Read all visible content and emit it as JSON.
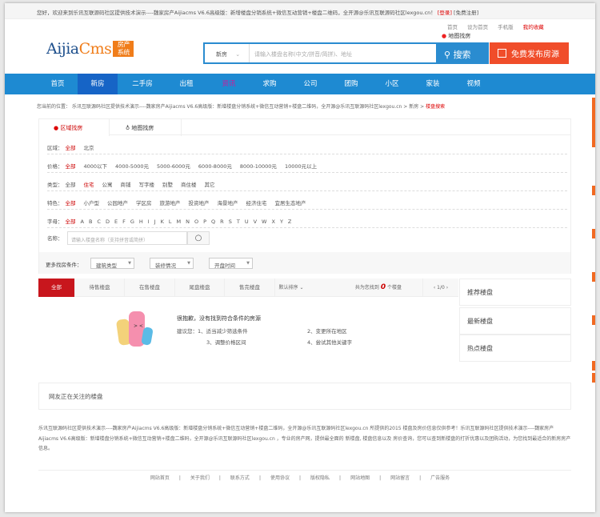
{
  "topbar": {
    "welcome": "您好，欢迎来到乐讯互联源码社区提供技术演示----魏家房产Aijiacms V6.6高级版：新增楼盘分销系统+微信互动营销+楼盘二维码，全开源@乐讯互联源码社区lexgou.cn！",
    "login": "[登录]",
    "register": "[免费注册]"
  },
  "toplinks": [
    "首页",
    "设为首页",
    "手机版",
    "我的收藏"
  ],
  "map_find": "地图找房",
  "logo": {
    "text1": "Aijia",
    "text2": "Cms",
    "tag1": "房产",
    "tag2": "系统"
  },
  "search": {
    "type": "新房",
    "placeholder": "请输入楼盘名称(中文/拼音/简拼)、地址",
    "button": "搜索"
  },
  "publish_button": "免费发布房源",
  "nav": [
    "首页",
    "新房",
    "二手房",
    "出租",
    "资讯",
    "求购",
    "公司",
    "团购",
    "小区",
    "家装",
    "视频"
  ],
  "breadcrumb": {
    "prefix": "您当前的位置：",
    "site": "乐讯互联源码社区提供技术演示----魏家房产Aijiacms V6.6高级版：新增楼盘分销系统+微信互动营销+楼盘二维码，全开源@乐讯互联源码社区lexgou.cn",
    "sep": ">",
    "item1": "新房",
    "item2": "楼盘搜索"
  },
  "filter": {
    "tabs": [
      "区域找房",
      "地图找房"
    ],
    "rows": [
      {
        "label": "区域：",
        "opts": [
          "全部",
          "北京"
        ],
        "active": 0
      },
      {
        "label": "价格：",
        "opts": [
          "全部",
          "4000以下",
          "4000-5000元",
          "5000-6000元",
          "6000-8000元",
          "8000-10000元",
          "10000元以上"
        ],
        "active": 0
      },
      {
        "label": "类型：",
        "opts": [
          "全部",
          "住宅",
          "公寓",
          "商铺",
          "写字楼",
          "别墅",
          "商住楼",
          "其它"
        ],
        "active": 1
      },
      {
        "label": "特色：",
        "opts": [
          "全部",
          "小户型",
          "公园地产",
          "学区房",
          "旅游地产",
          "投资地产",
          "海景地产",
          "经济住宅",
          "宜居生态地产"
        ],
        "active": 0
      },
      {
        "label": "字母：",
        "opts": [
          "全部",
          "A",
          "B",
          "C",
          "D",
          "E",
          "F",
          "G",
          "H",
          "I",
          "J",
          "K",
          "L",
          "M",
          "N",
          "O",
          "P",
          "Q",
          "R",
          "S",
          "T",
          "U",
          "V",
          "W",
          "X",
          "Y",
          "Z"
        ],
        "active": 0
      }
    ],
    "name_label": "名称：",
    "name_placeholder": "请输入楼盘名称（支持拼音或简拼）",
    "more_label": "更多找房条件：",
    "selects": [
      "建筑类型",
      "装修情况",
      "开盘时间"
    ]
  },
  "results": {
    "tabs": [
      "全部",
      "待售楼盘",
      "在售楼盘",
      "尾盘楼盘",
      "售完楼盘"
    ],
    "sort": "默认排序",
    "count_prefix": "共为您找到",
    "count": "0",
    "count_suffix": "个楼盘",
    "page": "1/0"
  },
  "empty": {
    "title": "很抱歉，没有找到符合条件的房源",
    "suggest": "建议您：1、适当减少筛选条件",
    "s2": "2、变更所在地区",
    "s3": "3、调整价格区间",
    "s4": "4、尝试其他关键字"
  },
  "sidebar": [
    "推荐楼盘",
    "最新楼盘",
    "热点楼盘"
  ],
  "follow_title": "网友正在关注的楼盘",
  "footer_text": "乐讯互联源码社区提供技术演示----魏家房产Aijiacms V6.6高级版：新增楼盘分销系统+微信互动营销+楼盘二维码，全开源@乐讯互联源码社区lexgou.cn 所提供的2015 楼盘及房价信息仅供参考！乐讯互联源码社区提供技术演示----魏家房产Aijiacms V6.6高级版：新增楼盘分销系统+微信互动营销+楼盘二维码，全开源@乐讯互联源码社区lexgou.cn ，专业的房产网，提供最全面的 新楼盘, 楼盘信息以及 房价查询，您可以查到新楼盘的打折优惠以及团购活动，为您找到最适合的新房房产信息。",
  "footer_links": [
    "网站首页",
    "关于我们",
    "联系方式",
    "使用协议",
    "版权隐私",
    "网站地图",
    "网站留言",
    "广告服务"
  ],
  "colors": {
    "nav": "#1e8ad2",
    "nav_active": "#1664c6",
    "accent": "#c8161d",
    "publish": "#f04d2a",
    "logo_orange": "#f07d1a"
  }
}
